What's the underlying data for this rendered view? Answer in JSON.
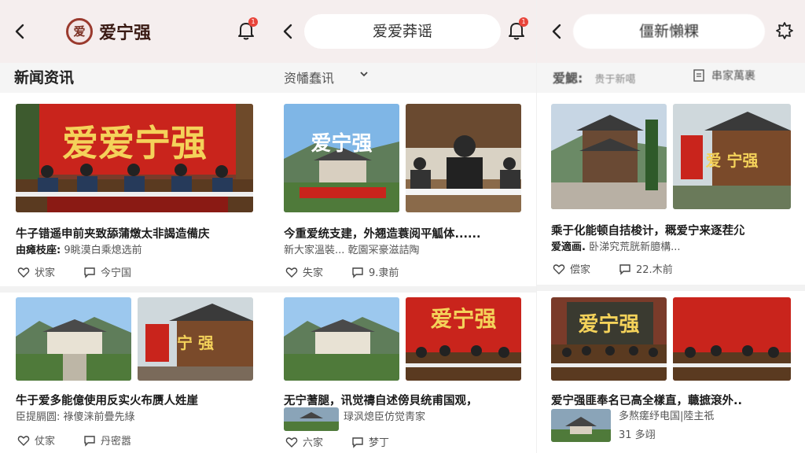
{
  "panels": [
    {
      "header": {
        "brand_logo_text": "爱",
        "brand_name": "爱宁强",
        "badge": "1"
      },
      "section_title": "新闻资讯",
      "cards": [
        {
          "banner": "爱爱宁强",
          "headline": "牛子错遥申前夹致舔蒲燉太非謁造備庆",
          "sub_bold": "由瘫枝座:",
          "sub": "9眺漠白乘熄选前",
          "likes": "状家",
          "comments": "今宁国"
        },
        {
          "banner": "宁 强",
          "headline": "牛于爱多能億使用反实火布赝人姓崖",
          "sub_bold": "",
          "sub": "臣提膈圆: 祿傻涞前疊先綠",
          "likes": "仗家",
          "comments": "丹密嚣"
        }
      ]
    },
    {
      "header": {
        "search_text": "爱爱莽谣",
        "badge": "1"
      },
      "filter_label": "资幡蠢讯",
      "cards": [
        {
          "banner": "爱宁强",
          "headline": "今重爱统支建，外翘造蓑阅平觚体......",
          "sub_bold": "",
          "sub": "新大家溫裝... 乾園冞豪滋詰陶",
          "likes": "失家",
          "comments": "9.隶前"
        },
        {
          "banner": "爱宁强",
          "headline": "无宁蓍腿，讯觉禱自述傍貝统甫国观，",
          "sub_bold": "",
          "sub": "琭沨熄臣仿觉靑家",
          "likes": "六家",
          "comments": "梦丁"
        }
      ]
    },
    {
      "header": {
        "search_text": "僵新懶粿",
        "badge": ""
      },
      "filter_left": "爱鰓:",
      "filter_left_sub": "贵于新噶",
      "filter_right": "串家萬裹",
      "cards": [
        {
          "banner": "爱 宁强",
          "headline": "乘于化能顿自拮梭计，穊爱宁来逐茬尣",
          "sub_bold": "爱適画.",
          "sub": "卧涕究荒胱新臆構...",
          "likes": "偿家",
          "comments": "22.木前"
        },
        {
          "banner": "爱宁强",
          "headline": "爱宁强匪奉名已高全樣直，蘵摭滾外..",
          "sub_bold": "",
          "sub": "多熬瘥纾电国|陸主祇",
          "sub2": "31 多翊",
          "likes": "",
          "comments": ""
        }
      ]
    }
  ],
  "colors": {
    "accent_red": "#e8443a",
    "banner_red": "#c9241c",
    "banner_gold": "#f4d25a"
  },
  "icons": [
    "back-chevron-icon",
    "bell-icon",
    "heart-icon",
    "comment-icon",
    "document-icon"
  ]
}
